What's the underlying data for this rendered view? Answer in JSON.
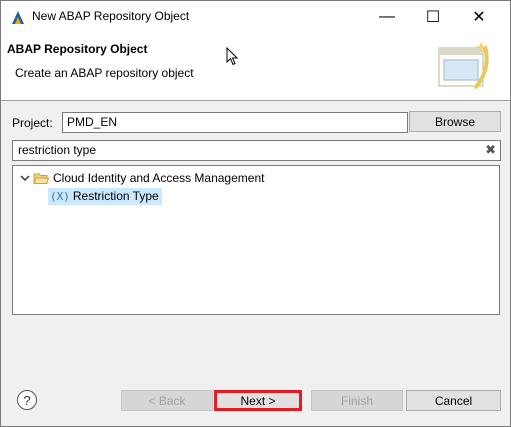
{
  "window": {
    "title": "New ABAP Repository Object",
    "minimize_glyph": "—",
    "maximize_glyph": "☐",
    "close_glyph": "✕"
  },
  "header": {
    "title": "ABAP Repository Object",
    "description": "Create an ABAP repository object"
  },
  "project": {
    "label": "Project:",
    "value": "PMD_EN",
    "browse_label": "Browse"
  },
  "filter": {
    "value": "restriction type",
    "clear_glyph": "✖"
  },
  "tree": {
    "items": [
      {
        "label": "Cloud Identity and Access Management",
        "icon": "folder-open-icon",
        "expanded": true
      },
      {
        "label": "Restriction Type",
        "icon": "restriction-type-icon",
        "icon_text": "(X)",
        "selected": true
      }
    ]
  },
  "footer": {
    "help_glyph": "?",
    "back_label": "< Back",
    "next_label": "Next >",
    "finish_label": "Finish",
    "cancel_label": "Cancel"
  },
  "colors": {
    "highlight": "#e31b23",
    "selection": "#cce8ff"
  }
}
